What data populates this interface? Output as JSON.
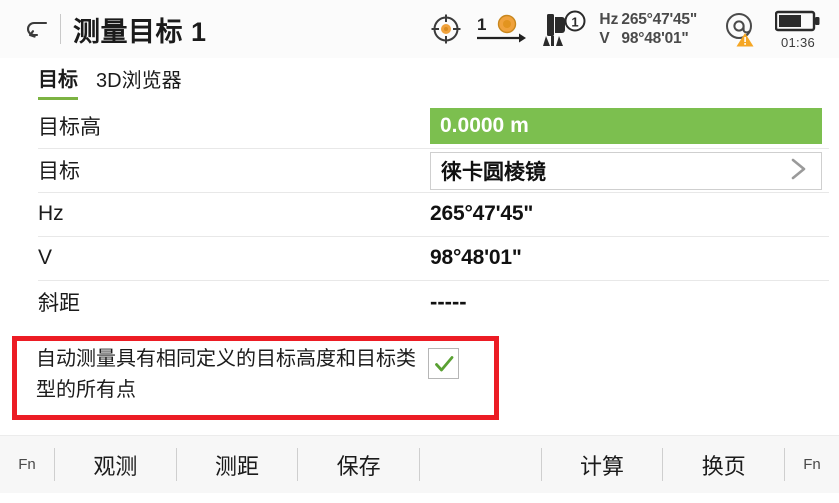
{
  "header": {
    "back_icon": "back-arrow-icon",
    "title": "测量目标 1",
    "status": {
      "crosshair_icon": "target-crosshair-icon",
      "prism_number": "1",
      "prism_icon": "prism-arrow-icon",
      "station_icon": "total-station-icon",
      "station_badge": "1",
      "hz_label": "Hz",
      "hz_value": "265°47'45\"",
      "v_label": "V",
      "v_value": "98°48'01\"",
      "at_icon": "at-sign-warning-icon",
      "battery_icon": "battery-icon",
      "battery_time": "01:36"
    }
  },
  "tabs": [
    {
      "label": "目标",
      "active": true
    },
    {
      "label": "3D浏览器",
      "active": false
    }
  ],
  "form": {
    "target_height": {
      "label": "目标高",
      "value": "0.0000 m"
    },
    "target": {
      "label": "目标",
      "value": "徕卡圆棱镜",
      "chevron_icon": "chevron-right-icon"
    },
    "hz": {
      "label": "Hz",
      "value": "265°47'45\""
    },
    "v": {
      "label": "V",
      "value": "98°48'01\""
    },
    "slope_distance": {
      "label": "斜距",
      "value": "-----"
    }
  },
  "auto_measure": {
    "text": "自动测量具有相同定义的目标高度和目标类型的所有点",
    "checked": true,
    "check_icon": "checkmark-icon",
    "highlight_color": "#ec1c24"
  },
  "toolbar": {
    "fn_left": "Fn",
    "buttons": [
      "观测",
      "测距",
      "保存"
    ],
    "buttons_right": [
      "计算",
      "换页"
    ],
    "fn_right": "Fn"
  },
  "colors": {
    "green_field": "#7cbf4f",
    "tab_underline": "#7cb342",
    "accent_orange": "#f5a623",
    "annotation_red": "#ec1c24"
  }
}
